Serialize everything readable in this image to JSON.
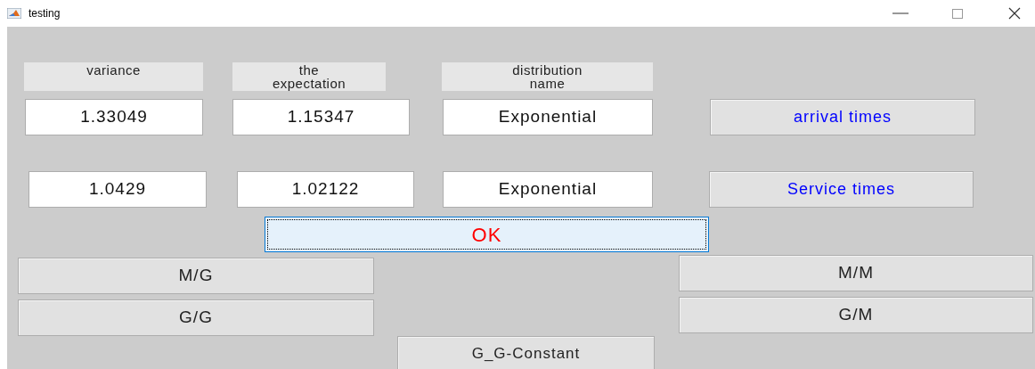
{
  "window": {
    "title": "testing"
  },
  "headers": [
    "variance",
    "the expectation",
    "distribution name"
  ],
  "rows": [
    {
      "values": [
        "1.33049",
        "1.15347",
        "Exponential"
      ],
      "button": {
        "label": "arrival times",
        "color": "#0000ff"
      }
    },
    {
      "values": [
        "1.0429",
        "1.02122",
        "Exponential"
      ],
      "button": {
        "label": "Service times",
        "color": "#0000ff"
      }
    }
  ],
  "ok_button": {
    "label": "OK",
    "color": "#ff0000",
    "focused": true
  },
  "model_buttons": [
    {
      "label": "M/G"
    },
    {
      "label": "M/M"
    },
    {
      "label": "G/G"
    },
    {
      "label": "G/M"
    }
  ],
  "constant_button": {
    "label": "G_G-Constant"
  }
}
